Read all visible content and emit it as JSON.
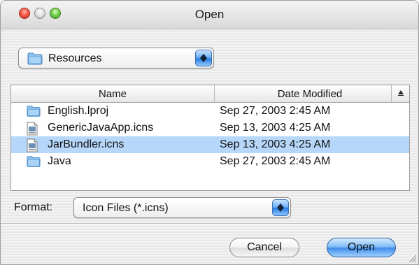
{
  "window": {
    "title": "Open"
  },
  "location": {
    "selected": "Resources"
  },
  "browser": {
    "columns": {
      "name": "Name",
      "date": "Date Modified"
    },
    "rows": [
      {
        "name": "English.lproj",
        "date": "Sep 27, 2003 2:45 AM",
        "icon": "folder-icon",
        "selected": false
      },
      {
        "name": "GenericJavaApp.icns",
        "date": "Sep 13, 2003 4:25 AM",
        "icon": "icns-file-icon",
        "selected": false
      },
      {
        "name": "JarBundler.icns",
        "date": "Sep 13, 2003 4:25 AM",
        "icon": "icns-file-icon",
        "selected": true
      },
      {
        "name": "Java",
        "date": "Sep 27, 2003 2:45 AM",
        "icon": "folder-icon",
        "selected": false
      }
    ]
  },
  "format": {
    "label": "Format:",
    "selected": "Icon Files (*.icns)"
  },
  "buttons": {
    "cancel": "Cancel",
    "open": "Open"
  },
  "colors": {
    "selection": "#b6d7fa",
    "accent": "#3c8be8"
  }
}
